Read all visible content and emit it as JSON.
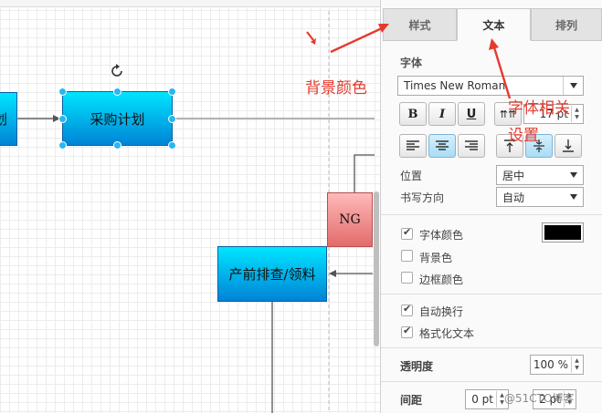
{
  "canvas": {
    "partial_node_label": "划",
    "selected_node_label": "采购计划",
    "ng_node_label": "NG",
    "check_node_label": "产前排查/领料"
  },
  "panel": {
    "tabs": [
      "样式",
      "文本",
      "排列"
    ],
    "active_tab": "文本",
    "font_section_title": "字体",
    "font_family": "Times New Roman",
    "bold": "B",
    "italic": "I",
    "underline": "U",
    "font_size": "17 pt",
    "position_label": "位置",
    "position_value": "居中",
    "writing_dir_label": "书写方向",
    "writing_dir_value": "自动",
    "font_color_label": "字体颜色",
    "font_color_value": "#000000",
    "bg_color_label": "背景色",
    "border_color_label": "边框颜色",
    "word_wrap_label": "自动换行",
    "formatted_text_label": "格式化文本",
    "opacity_label": "透明度",
    "opacity_value": "100 %",
    "spacing_label": "间距",
    "spacing_value_1": "0 pt",
    "spacing_value_2": "2 pt"
  },
  "annotations": {
    "bg_color": "背景颜色",
    "font_settings_line1": "字体相关",
    "font_settings_line2": "设置"
  },
  "watermark": "@51CTO博客",
  "colors": {
    "accent_annotation": "#e63a2e",
    "node_blue_top": "#00e5ff",
    "node_blue_bottom": "#0083d6",
    "node_red_top": "#ffb9b9",
    "node_red_bottom": "#e36b6b",
    "selection_handle": "#29b6f2"
  }
}
